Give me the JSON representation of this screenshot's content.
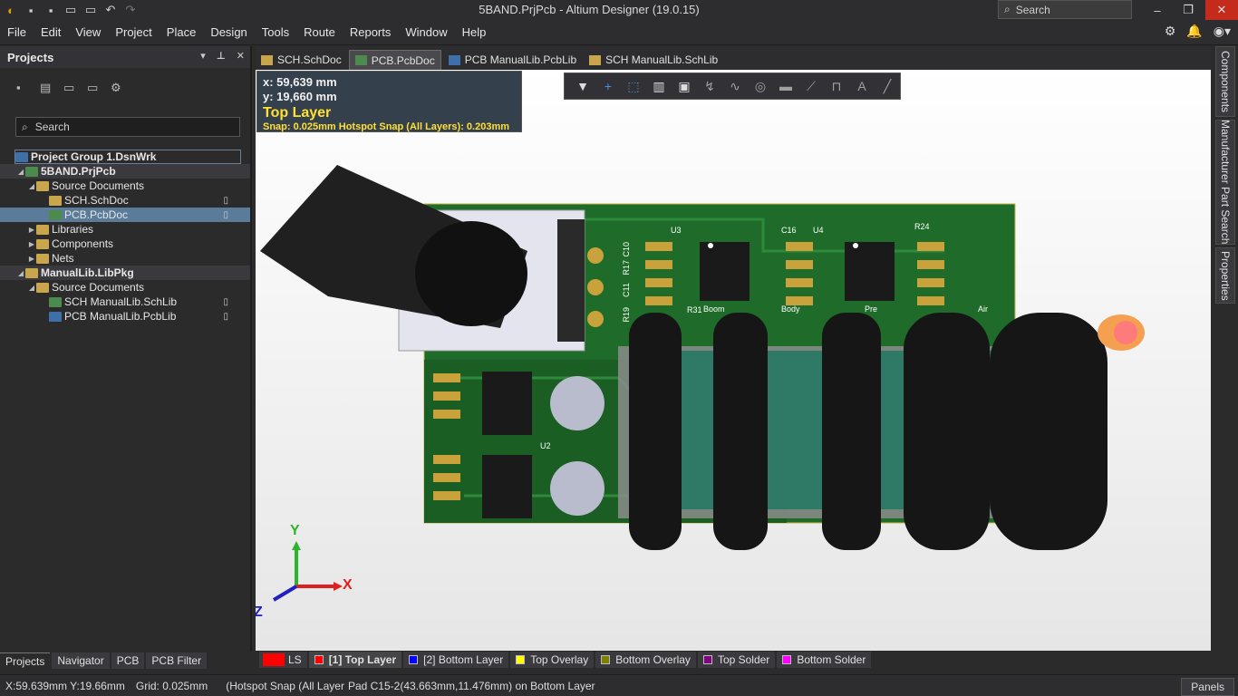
{
  "titlebar": {
    "title": "5BAND.PrjPcb - Altium Designer (19.0.15)",
    "search_placeholder": "Search"
  },
  "menu": [
    "File",
    "Edit",
    "View",
    "Project",
    "Place",
    "Design",
    "Tools",
    "Route",
    "Reports",
    "Window",
    "Help"
  ],
  "projects_panel": {
    "title": "Projects",
    "search_placeholder": "Search",
    "tree": [
      {
        "label": "Project Group 1.DsnWrk",
        "level": 0,
        "icon": "workspace-icon"
      },
      {
        "label": "5BAND.PrjPcb",
        "level": 1,
        "icon": "project-icon"
      },
      {
        "label": "Source Documents",
        "level": 2,
        "icon": "folder-icon"
      },
      {
        "label": "SCH.SchDoc",
        "level": 3,
        "icon": "schdoc-icon"
      },
      {
        "label": "PCB.PcbDoc",
        "level": 3,
        "icon": "pcbdoc-icon"
      },
      {
        "label": "Libraries",
        "level": 2,
        "icon": "folder-icon"
      },
      {
        "label": "Components",
        "level": 2,
        "icon": "folder-icon"
      },
      {
        "label": "Nets",
        "level": 2,
        "icon": "folder-icon"
      },
      {
        "label": "ManualLib.LibPkg",
        "level": 1,
        "icon": "libpkg-icon"
      },
      {
        "label": "Source Documents",
        "level": 2,
        "icon": "folder-icon"
      },
      {
        "label": "SCH ManualLib.SchLib",
        "level": 3,
        "icon": "schlib-icon"
      },
      {
        "label": "PCB ManualLib.PcbLib",
        "level": 3,
        "icon": "pcblib-icon"
      }
    ],
    "bottom_tabs": [
      "Projects",
      "Navigator",
      "PCB",
      "PCB Filter"
    ]
  },
  "doc_tabs": [
    {
      "label": "SCH.SchDoc"
    },
    {
      "label": "PCB.PcbDoc"
    },
    {
      "label": "PCB ManualLib.PcbLib"
    },
    {
      "label": "SCH ManualLib.SchLib"
    }
  ],
  "coord_overlay": {
    "x": "x: 59,639 mm",
    "y": "y: 19,660 mm",
    "layer": "Top Layer",
    "snap": "Snap: 0.025mm Hotspot Snap (All Layers): 0.203mm"
  },
  "axis": {
    "x": "X",
    "y": "Y",
    "z": "Z"
  },
  "right_tabs": [
    "Components",
    "Manufacturer Part Search",
    "Properties"
  ],
  "layers": {
    "ls": "LS",
    "items": [
      {
        "label": "[1] Top Layer",
        "color": "#ff0000"
      },
      {
        "label": "[2] Bottom Layer",
        "color": "#0000ff"
      },
      {
        "label": "Top Overlay",
        "color": "#ffff00"
      },
      {
        "label": "Bottom Overlay",
        "color": "#808000"
      },
      {
        "label": "Top Solder",
        "color": "#800080"
      },
      {
        "label": "Bottom Solder",
        "color": "#ff00ff"
      }
    ]
  },
  "status": {
    "coords": "X:59.639mm Y:19.66mm",
    "grid": "Grid: 0.025mm",
    "snap": "(Hotspot Snap (All Layer",
    "pad": "Pad C15-2(43.663mm,11.476mm) on Bottom Layer",
    "panels": "Panels"
  },
  "pcb_labels": [
    "U3",
    "U4",
    "U2",
    "C16",
    "R24",
    "R31",
    "R19",
    "R17",
    "C10",
    "C11",
    "Boom",
    "Body",
    "Pre",
    "Air"
  ]
}
